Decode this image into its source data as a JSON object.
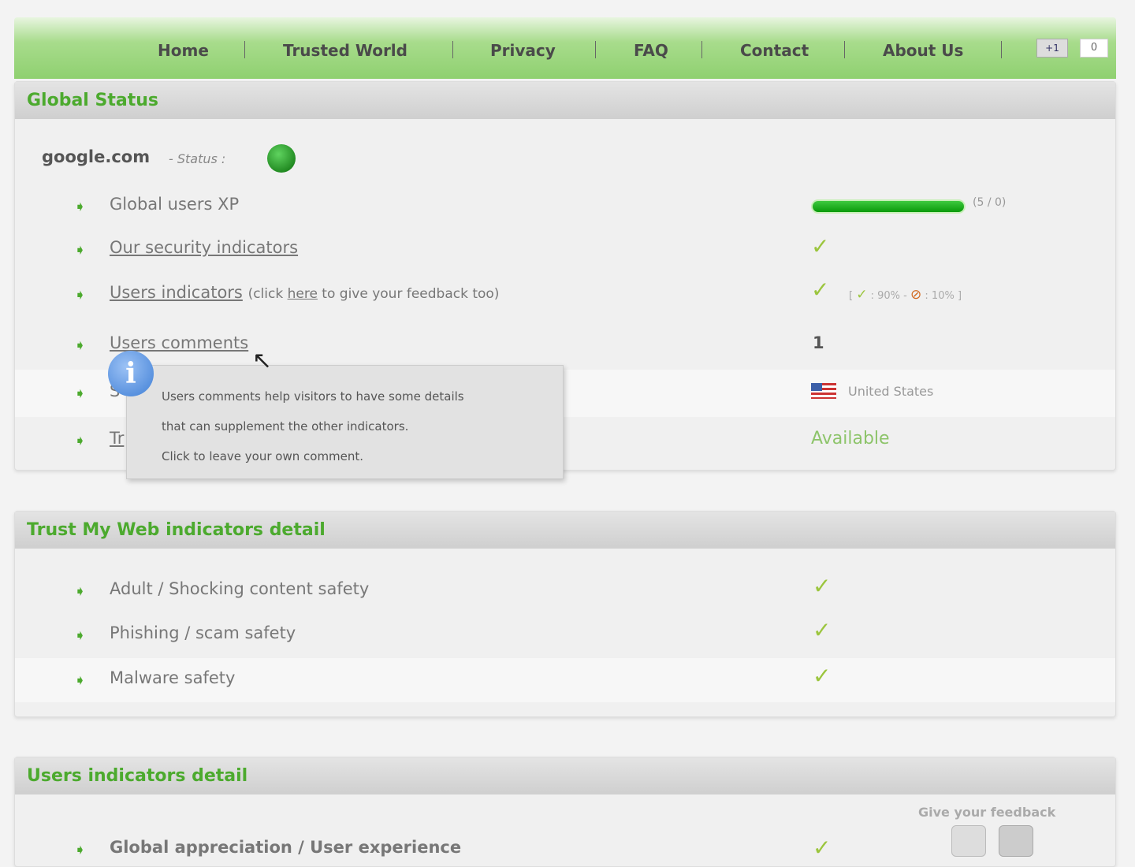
{
  "nav": {
    "items": [
      "Home",
      "Trusted World",
      "Privacy",
      "FAQ",
      "Contact",
      "About Us"
    ],
    "gplus_label": "+1",
    "gplus_count": "0"
  },
  "global_status": {
    "title": "Global Status",
    "domain": "google.com",
    "status_label": "- Status :",
    "rows": [
      {
        "label": "Global users XP",
        "progress_percent": 100,
        "progress_text": "(5 / 0)"
      },
      {
        "label": "Our security indicators",
        "value": "check"
      },
      {
        "label": "Users indicators",
        "extra_pre": "(click ",
        "extra_link": "here",
        "extra_post": " to give your feedback too)",
        "positive": ": 90%",
        "negative": ": 10%",
        "sep": "-",
        "open": "[",
        "close": "]"
      },
      {
        "label": "Users comments",
        "value": "1"
      },
      {
        "label": "S",
        "value": "United States"
      },
      {
        "label": "Tr",
        "value": "Available"
      }
    ],
    "tooltip": [
      "Users comments help visitors to have some details",
      "that can supplement the other indicators.",
      "Click to leave your own comment."
    ],
    "tooltip_icon": "i"
  },
  "trust_detail": {
    "title": "Trust My Web indicators detail",
    "rows": [
      "Adult / Shocking content safety",
      "Phishing / scam safety",
      "Malware safety"
    ]
  },
  "users_detail": {
    "title": "Users indicators detail",
    "feedback_label": "Give your feedback",
    "rows": [
      "Global appreciation / User experience"
    ]
  },
  "colors": {
    "accent": "#4caa2e",
    "check": "#9bc53d"
  }
}
